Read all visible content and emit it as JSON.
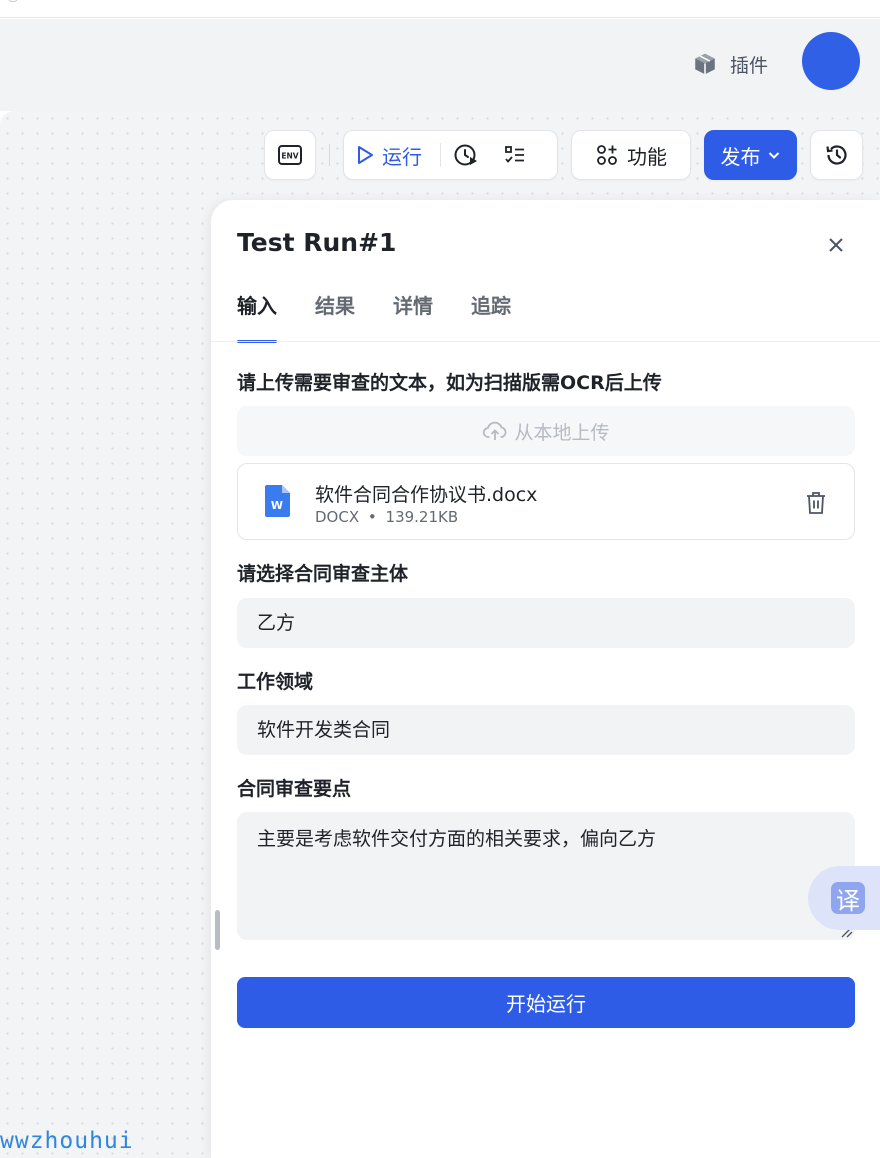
{
  "header": {
    "plugin_label": "插件",
    "plugin_icon": "cube-icon"
  },
  "toolbar": {
    "env_icon": "env-icon",
    "run_label": "运行",
    "function_label": "功能",
    "publish_label": "发布",
    "history_icon": "history-icon"
  },
  "panel": {
    "title": "Test Run#1",
    "tabs": [
      {
        "label": "输入",
        "active": true
      },
      {
        "label": "结果",
        "active": false
      },
      {
        "label": "详情",
        "active": false
      },
      {
        "label": "追踪",
        "active": false
      }
    ],
    "upload_section": {
      "label": "请上传需要审查的文本，如为扫描版需OCR后上传",
      "upload_button": "从本地上传",
      "file": {
        "name": "软件合同合作协议书.docx",
        "type": "DOCX",
        "separator": "•",
        "size": "139.21KB"
      }
    },
    "subject": {
      "label": "请选择合同审查主体",
      "value": "乙方"
    },
    "domain": {
      "label": "工作领域",
      "value": "软件开发类合同"
    },
    "key_points": {
      "label": "合同审查要点",
      "value": "主要是考虑软件交付方面的相关要求，偏向乙方"
    },
    "start_button": "开始运行"
  },
  "translate_bubble": {
    "label": "译"
  },
  "watermark": "wwzhouhui",
  "colors": {
    "accent": "#2f5ce6",
    "avatar": "#3060e6"
  }
}
